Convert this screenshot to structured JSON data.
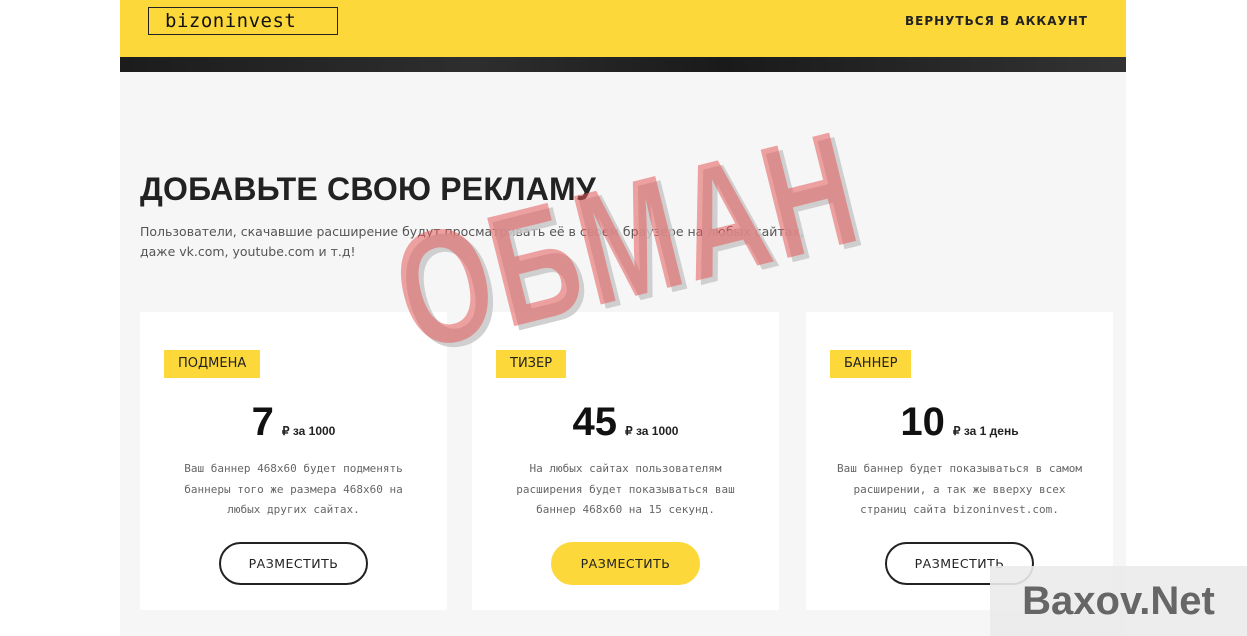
{
  "header": {
    "logo": "bizoninvest",
    "back_link": "ВЕРНУТЬСЯ В АККАУНТ"
  },
  "main": {
    "title": "ДОБАВЬТЕ СВОЮ РЕКЛАМУ",
    "description": "Пользователи, скачавшие расширение будут просматривать её в своем браузере на любых сайтах, даже vk.com, youtube.com и т.д!"
  },
  "cards": [
    {
      "badge": "ПОДМЕНА",
      "price": "7",
      "unit": "₽ за 1000",
      "description": "Ваш баннер 468x60 будет подменять баннеры того же размера 468x60 на любых других сайтах.",
      "button": "РАЗМЕСТИТЬ"
    },
    {
      "badge": "ТИЗЕР",
      "price": "45",
      "unit": "₽ за 1000",
      "description": "На любых сайтах пользователям расширения будет показываться ваш баннер 468x60 на 15 секунд.",
      "button": "РАЗМЕСТИТЬ"
    },
    {
      "badge": "БАННЕР",
      "price": "10",
      "unit": "₽ за 1 день",
      "description": "Ваш баннер будет показываться в самом расширении, а так же вверху всех страниц сайта bizoninvest.com.",
      "button": "РАЗМЕСТИТЬ"
    }
  ],
  "watermark": {
    "stamp": "ОБМАН",
    "site": "Baxov.Net"
  },
  "colors": {
    "accent": "#fcd83a",
    "stamp": "#e65a5a"
  }
}
